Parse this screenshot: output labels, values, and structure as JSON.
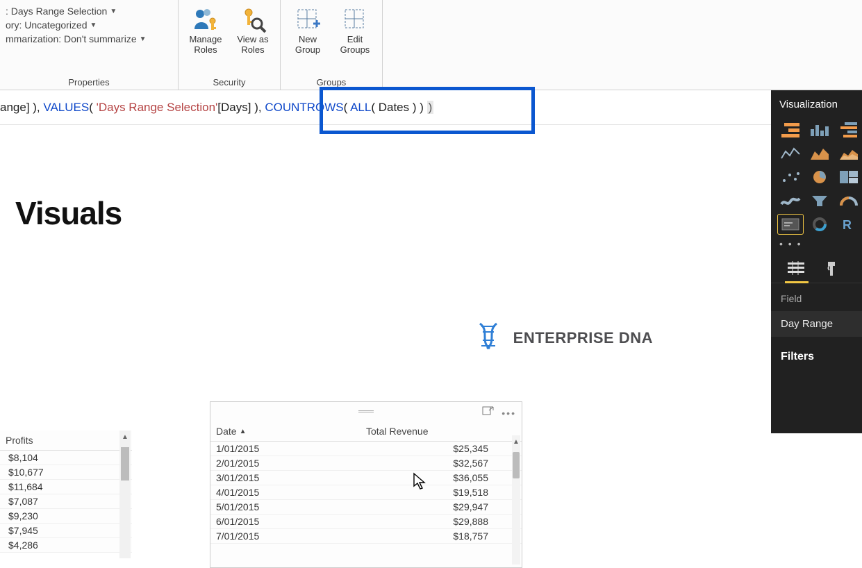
{
  "ribbon": {
    "properties": {
      "row1_label": ": Days Range Selection",
      "row2_label": "ory: Uncategorized",
      "row3_label": "mmarization: Don't summarize",
      "group_label": "Properties"
    },
    "security": {
      "manage_roles": "Manage\nRoles",
      "view_as_roles": "View as\nRoles",
      "group_label": "Security"
    },
    "groups": {
      "new_group": "New\nGroup",
      "edit_groups": "Edit\nGroups",
      "group_label": "Groups"
    }
  },
  "formula": {
    "p1": "ange] ), ",
    "p2": "VALUES",
    "p3": "( ",
    "p4": "'Days Range Selection'",
    "p5": "[Days] ), ",
    "p6": "COUNTROWS",
    "p7": "( ",
    "p8": "ALL",
    "p9": "( Dates ) ) ",
    "p10": ")"
  },
  "canvas": {
    "title": "Visuals",
    "logo_text": "ENTERPRISE DNA"
  },
  "table1": {
    "header": "Profits",
    "rows": [
      "$8,104",
      "$10,677",
      "$11,684",
      "$7,087",
      "$9,230",
      "$7,945",
      "$4,286"
    ]
  },
  "table2": {
    "headers": {
      "c1": "Date",
      "c2": "Total Revenue"
    },
    "rows": [
      {
        "d": "1/01/2015",
        "v": "$25,345"
      },
      {
        "d": "2/01/2015",
        "v": "$32,567"
      },
      {
        "d": "3/01/2015",
        "v": "$36,055"
      },
      {
        "d": "4/01/2015",
        "v": "$19,518"
      },
      {
        "d": "5/01/2015",
        "v": "$29,947"
      },
      {
        "d": "6/01/2015",
        "v": "$29,888"
      },
      {
        "d": "7/01/2015",
        "v": "$18,757"
      }
    ]
  },
  "vis_pane": {
    "title": "Visualization",
    "field_label": "Field",
    "well_value": "Day Range",
    "filters_label": "Filters"
  }
}
